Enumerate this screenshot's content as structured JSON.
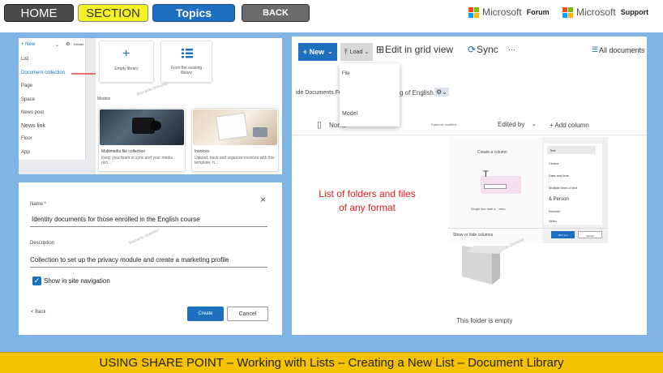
{
  "nav": {
    "home": "HOME",
    "section": "SECTION",
    "topics": "Topics",
    "back": "BACK"
  },
  "brand": {
    "forum_name": "Microsoft",
    "forum_label": "Forum",
    "support_name": "Microsoft",
    "support_label": "Support",
    "colors": [
      "#f25022",
      "#7fba00",
      "#00a4ef",
      "#ffb900"
    ]
  },
  "create_menu": {
    "new_label": "+ New",
    "details_label": "Details",
    "items": [
      "List",
      "Document collection",
      "Page",
      "Space",
      "News post",
      "News link",
      "Floor",
      "App"
    ]
  },
  "library_options": {
    "empty_library": "Empty library",
    "from_existing": "From the existing library",
    "models_label": "Models",
    "templates": [
      {
        "title": "Multimedia file collection",
        "desc": "Keep your team in sync and your media rich..."
      },
      {
        "title": "Invoices",
        "desc": "Upload, track and organize invoices with this template, n..."
      }
    ],
    "watermark": "Riccardo Dominici"
  },
  "dialog": {
    "name_label": "Name *",
    "name_value": "Identity documents for those enrolled in the English course",
    "description_label": "Description",
    "description_value": "Collection to set up the privacy module and create a marketing profile",
    "show_in_nav_label": "Show in site navigation",
    "back_label": "< Back",
    "create_label": "Create",
    "cancel_label": "Cancel",
    "watermark": "Riccardo Dominici"
  },
  "library_view": {
    "new_label": "+ New",
    "load_label": "Load",
    "edit_grid_label": "Edit in grid view",
    "sync_label": "Sync",
    "more_label": "···",
    "all_documents_label": "All documents",
    "dropdown_items": [
      "File",
      "Model"
    ],
    "breadcrumb_left": "ide Documents Folder",
    "breadcrumb_right": "g of English",
    "col_name": "Nome",
    "col_modified": "Data/ora modifica",
    "col_edited_by": "Edited by",
    "add_column": "+ Add column",
    "annotation": "List of folders and files of any format",
    "create_column_title": "Create a column",
    "single_line_label": "Single line mail d... reso",
    "show_hide_columns": "Show or hide columns",
    "column_types": [
      "Text",
      "Choice",
      "Date and time",
      "Multiple lines of text",
      "& Person",
      "Number",
      "Si/No"
    ],
    "next_button": "After you",
    "cancel_button": "Cancel",
    "empty_message": "This folder is empty",
    "watermark": "Riccardo Dominici"
  },
  "footer": {
    "caption": "USING SHARE POINT – Working with Lists – Creating a New List – Document Library"
  }
}
